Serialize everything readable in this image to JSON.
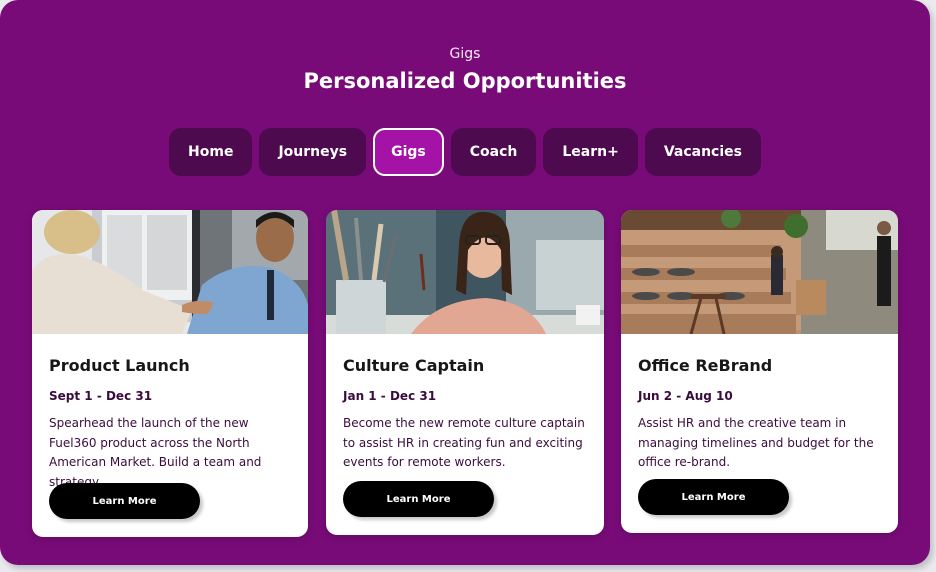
{
  "header": {
    "eyebrow": "Gigs",
    "title": "Personalized Opportunities"
  },
  "nav": {
    "tabs": [
      {
        "label": "Home"
      },
      {
        "label": "Journeys"
      },
      {
        "label": "Gigs",
        "active": true
      },
      {
        "label": "Coach"
      },
      {
        "label": "Learn+"
      },
      {
        "label": "Vacancies"
      }
    ]
  },
  "cards": [
    {
      "title": "Product Launch",
      "dates": "Sept 1 - Dec 31",
      "description": "Spearhead the launch of the new Fuel360 product across the North American Market. Build a team and strategy.",
      "button": "Learn More",
      "image": "handshake-meeting-photo"
    },
    {
      "title": "Culture Captain",
      "dates": "Jan 1 - Dec 31",
      "description": "Become the new remote culture captain to assist HR in creating fun and exciting events for remote workers.",
      "button": "Learn More",
      "image": "artist-woman-photo"
    },
    {
      "title": "Office ReBrand",
      "dates": "Jun 2 - Aug 10",
      "description": "Assist HR and the creative team in managing timelines and budget for the office re-brand.",
      "button": "Learn More",
      "image": "office-lounge-photo"
    }
  ],
  "colors": {
    "background": "#780b78",
    "tab": "#4d0a4e",
    "tab_active": "#a513a6",
    "button": "#000000",
    "body_text": "#3a0c3d"
  }
}
